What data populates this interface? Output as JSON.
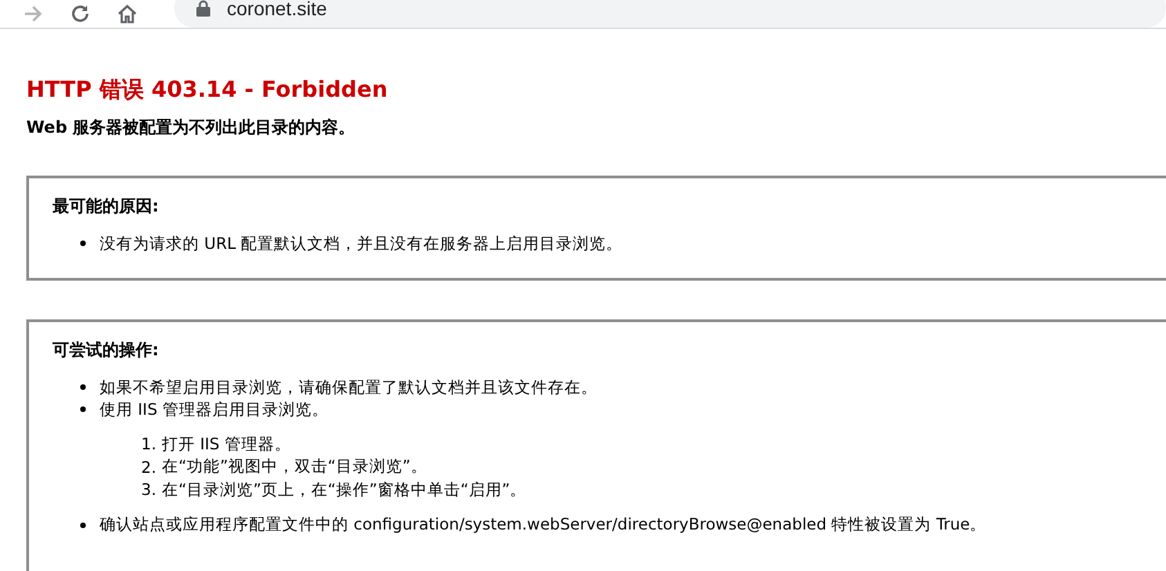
{
  "browser": {
    "back_disabled": true,
    "address": "coronet.site"
  },
  "title": "HTTP 错误 403.14 - Forbidden",
  "subtitle": "Web 服务器被配置为不列出此目录的内容。",
  "sections": [
    {
      "heading": "最可能的原因:",
      "items": [
        {
          "kind": "bullet",
          "text": "没有为请求的 URL 配置默认文档，并且没有在服务器上启用目录浏览。"
        }
      ]
    },
    {
      "heading": "可尝试的操作:",
      "items": [
        {
          "kind": "bullet",
          "text": "如果不希望启用目录浏览，请确保配置了默认文档并且该文件存在。"
        },
        {
          "kind": "bullet",
          "text": "使用 IIS 管理器启用目录浏览。"
        },
        {
          "kind": "steps",
          "steps": [
            {
              "number": "1.",
              "text": "打开 IIS 管理器。"
            },
            {
              "number": "2.",
              "text": "在“功能”视图中，双击“目录浏览”。"
            },
            {
              "number": "3.",
              "text": "在“目录浏览”页上，在“操作”窗格中单击“启用”。"
            }
          ]
        },
        {
          "kind": "bullet",
          "text": "确认站点或应用程序配置文件中的 configuration/system.webServer/directoryBrowse@enabled 特性被设置为 True。"
        }
      ]
    }
  ]
}
